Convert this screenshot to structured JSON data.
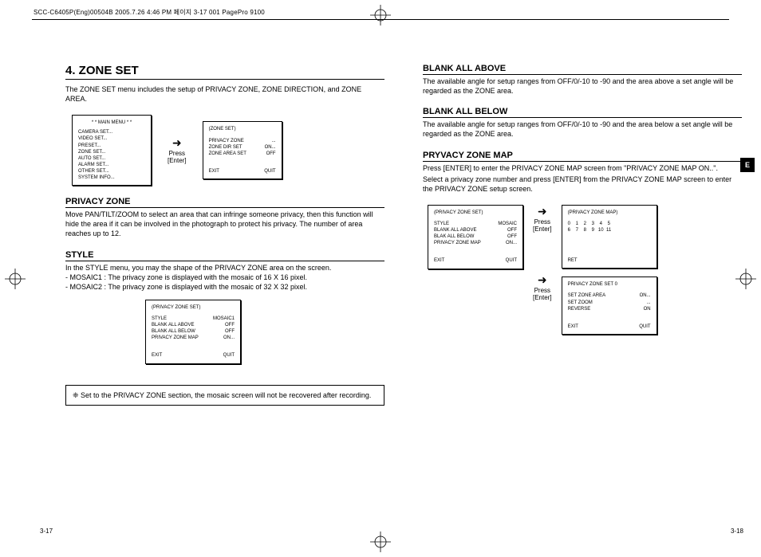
{
  "header": "SCC-C6405P(Eng)00504B  2005.7.26 4:46 PM  페이지 3-17   001 PagePro 9100",
  "side_tab": "E",
  "left": {
    "title": "4. ZONE SET",
    "intro": "The ZONE SET menu includes the setup of PRIVACY ZONE, ZONE DIRECTION, and ZONE AREA.",
    "main_menu": {
      "title": "* * MAIN MENU * *",
      "items": [
        "CAMERA SET...",
        "VIDEO SET...",
        "PRESET...",
        "ZONE SET...",
        "AUTO SET...",
        "ALARM SET...",
        "OTHER SET...",
        "SYSTEM INFO..."
      ]
    },
    "arrow": {
      "glyph": "➜",
      "l1": "Press",
      "l2": "[Enter]"
    },
    "zone_set_menu": {
      "title": "(ZONE SET)",
      "rows": [
        {
          "k": "PRIVACY ZONE",
          "v": "..."
        },
        {
          "k": "ZONE DIR SET",
          "v": "ON..."
        },
        {
          "k": "ZONE AREA SET",
          "v": "OFF"
        }
      ],
      "exit": "EXIT",
      "quit": "QUIT"
    },
    "privacy_title": "PRIVACY ZONE",
    "privacy_text": "Move PAN/TILT/ZOOM to select an area that can infringe someone privacy, then this function will hide the area if it can be involved in the photograph to protect his privacy. The number of area reaches up to 12.",
    "style_title": "STYLE",
    "style_text1": "In the STYLE menu, you may the shape of the PRIVACY ZONE area on the screen.",
    "style_text2": "- MOSAIC1 : The privacy zone is displayed with the mosaic of 16 X 16 pixel.",
    "style_text3": "- MOSAIC2 : The privacy zone is displayed with the mosaic of 32 X 32 pixel.",
    "style_menu": {
      "title": "(PRIVACY ZONE SET)",
      "rows": [
        {
          "k": "STYLE",
          "v": "MOSAIC1"
        },
        {
          "k": "BLANK ALL ABOVE",
          "v": "OFF"
        },
        {
          "k": "BLANK ALL BELOW",
          "v": "OFF"
        },
        {
          "k": "PRIVACY ZONE MAP",
          "v": "ON..."
        }
      ],
      "exit": "EXIT",
      "quit": "QUIT"
    },
    "note": "❈ Set to the PRIVACY ZONE section, the mosaic screen will not be recovered after recording.",
    "footer": "3-17"
  },
  "right": {
    "baa_title": "BLANK ALL ABOVE",
    "baa_text": "The available angle for setup ranges from OFF/0/-10 to -90 and the area above a set angle will be regarded as the ZONE area.",
    "bab_title": "BLANK ALL BELOW",
    "bab_text": "The available angle for setup ranges from OFF/0/-10 to -90 and the area below a set angle will be regarded as the ZONE area.",
    "pzm_title": "PRYVACY ZONE MAP",
    "pzm_text1": "Press [ENTER] to enter the PRIVACY ZONE MAP screen from \"PRIVACY ZONE MAP ON..\".",
    "pzm_text2": "Select a privacy zone number and press [ENTER] from the PRIVACY ZONE MAP screen to enter the PRIVACY ZONE setup screen.",
    "pzs_menu": {
      "title": "(PRIVACY ZONE SET)",
      "rows": [
        {
          "k": "STYLE",
          "v": "MOSAIC"
        },
        {
          "k": "BLANK ALL ABOVE",
          "v": "OFF"
        },
        {
          "k": "BLAK ALL BELOW",
          "v": "OFF"
        },
        {
          "k": "PRIVACY ZONE MAP",
          "v": "ON..."
        }
      ],
      "exit": "EXIT",
      "quit": "QUIT"
    },
    "pzm_menu": {
      "title": "(PRIVACY ZONE MAP)",
      "row1": "0    1    2    3    4    5",
      "row2": "6    7    8    9   10  11",
      "ret": "RET"
    },
    "pzs0_menu": {
      "title": "PRIVACY ZONE SET   0",
      "rows": [
        {
          "k": "SET ZONE AREA",
          "v": "ON..."
        },
        {
          "k": "SET ZOOM",
          "v": "..."
        },
        {
          "k": "REVERSE",
          "v": "ON"
        }
      ],
      "exit": "EXIT",
      "quit": "QUIT"
    },
    "footer": "3-18"
  }
}
